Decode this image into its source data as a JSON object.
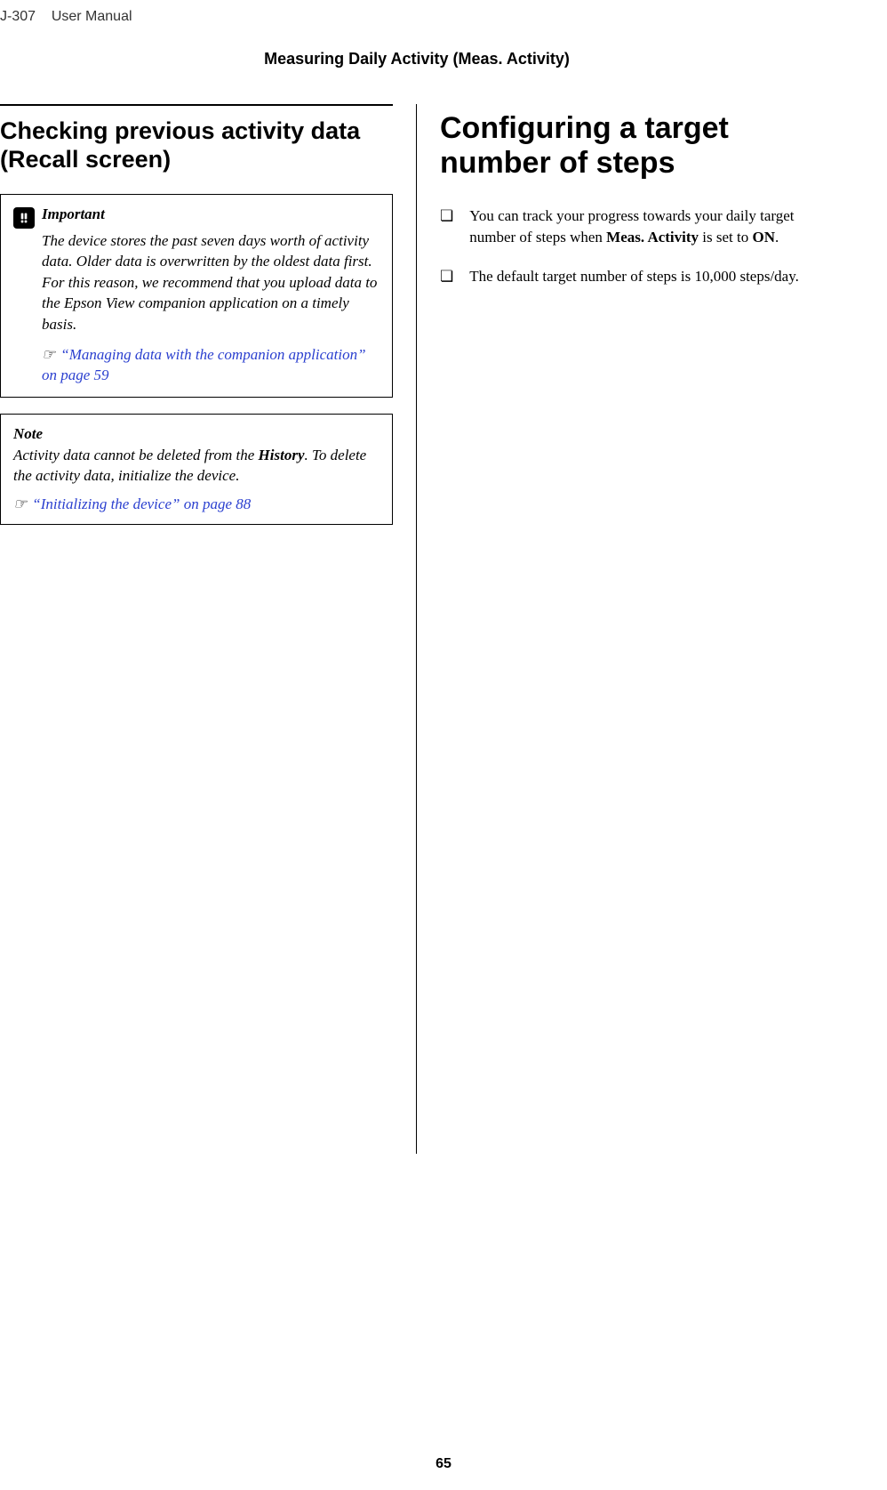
{
  "header": {
    "model": "J-307",
    "label": "User Manual"
  },
  "section_title": "Measuring Daily Activity (Meas. Activity)",
  "left": {
    "heading": "Checking previous activity data (Recall screen)",
    "important": {
      "label": "Important",
      "body": "The device stores the past seven days worth of activity data. Older data is overwritten by the oldest data first. For this reason, we recommend that you upload data to the Epson View companion application on a timely basis.",
      "link_prefix": "☞",
      "link_text": "“Managing data with the companion application” on page 59"
    },
    "note": {
      "label": "Note",
      "body_pre": "Activity data cannot be deleted from the ",
      "body_bold": "History",
      "body_post": ". To delete the activity data, initialize the device.",
      "link_prefix": "☞",
      "link_text": "“Initializing the device” on page 88"
    }
  },
  "right": {
    "heading": "Configuring a target number of steps",
    "items": [
      {
        "pre": "You can track your progress towards your daily target number of steps when ",
        "b1": "Meas. Activity",
        "mid": " is set to ",
        "b2": "ON",
        "post": "."
      },
      {
        "pre": "The default target number of steps is 10,000 steps/day.",
        "b1": "",
        "mid": "",
        "b2": "",
        "post": ""
      }
    ]
  },
  "page_number": "65"
}
